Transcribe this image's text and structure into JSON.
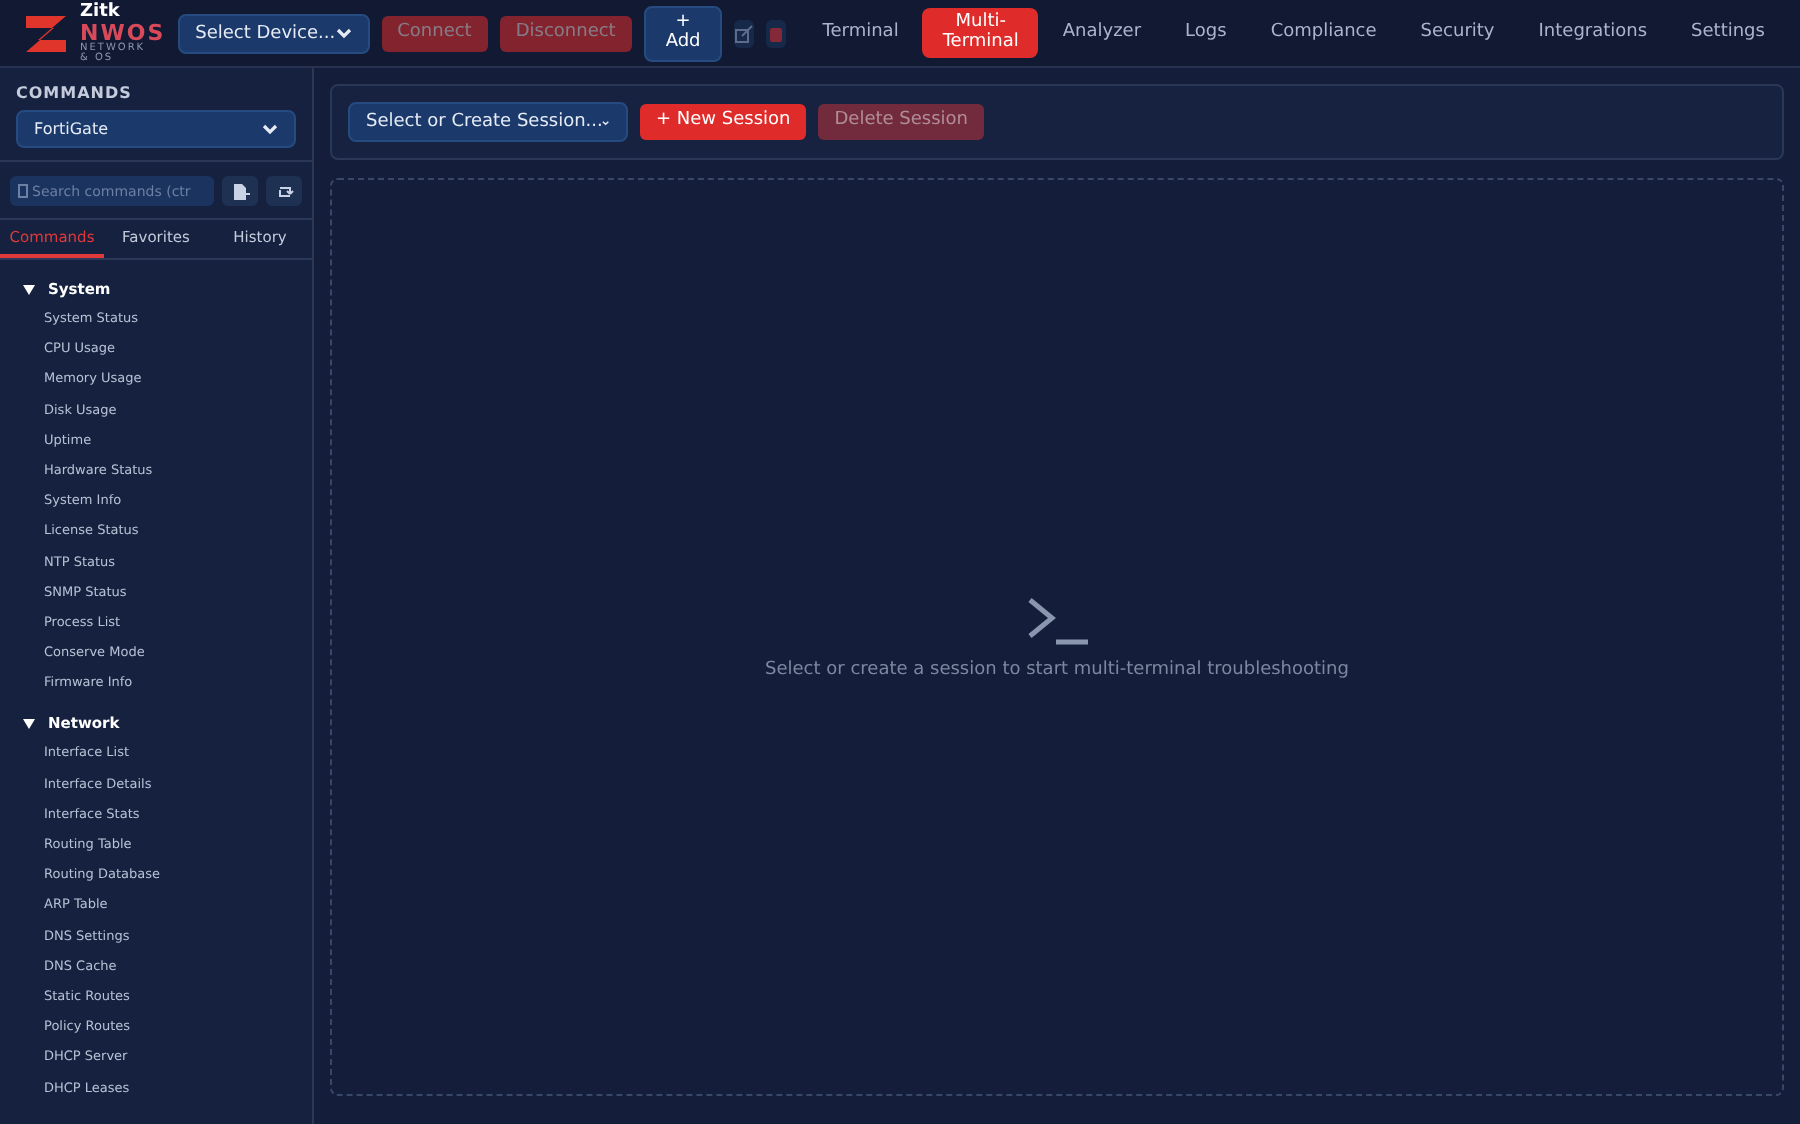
{
  "logo": {
    "top": "Zitk",
    "name": "NWOS",
    "tagline": "NETWORK & OS"
  },
  "header": {
    "device_select": "Select Device...",
    "buttons": [
      {
        "label": "Connect",
        "kind": "danger",
        "disabled": true
      },
      {
        "label": "Disconnect",
        "kind": "danger",
        "disabled": true
      },
      {
        "label": "+\nAdd",
        "kind": "primary",
        "disabled": false
      }
    ],
    "icon_buttons": [
      {
        "kind": "edit",
        "disabled": true
      },
      {
        "kind": "delete",
        "disabled": true
      }
    ],
    "nav": [
      {
        "label": "Terminal",
        "selected": false
      },
      {
        "label": "Multi-\nTerminal",
        "selected": true
      },
      {
        "label": "Analyzer",
        "selected": false
      },
      {
        "label": "Logs",
        "selected": false
      },
      {
        "label": "Compliance",
        "selected": false
      },
      {
        "label": "Security",
        "selected": false
      },
      {
        "label": "Integrations",
        "selected": false
      },
      {
        "label": "Settings",
        "selected": false
      }
    ]
  },
  "sidebar": {
    "title": "COMMANDS",
    "vendor_select": "FortiGate",
    "search": {
      "placeholder": "Search commands (ctr"
    },
    "tabs": [
      {
        "label": "Commands",
        "selected": true
      },
      {
        "label": "Favorites",
        "selected": false
      },
      {
        "label": "History",
        "selected": false
      }
    ],
    "groups": [
      {
        "label": "System",
        "expanded": true,
        "children": [
          "System Status",
          "CPU Usage",
          "Memory Usage",
          "Disk Usage",
          "Uptime",
          "Hardware Status",
          "System Info",
          "License Status",
          "NTP Status",
          "SNMP Status",
          "Process List",
          "Conserve Mode",
          "Firmware Info"
        ]
      },
      {
        "label": "Network",
        "expanded": true,
        "children": [
          "Interface List",
          "Interface Details",
          "Interface Stats",
          "Routing Table",
          "Routing Database",
          "ARP Table",
          "DNS Settings",
          "DNS Cache",
          "Static Routes",
          "Policy Routes",
          "DHCP Server",
          "DHCP Leases"
        ]
      }
    ]
  },
  "session_bar": {
    "session_select": "Select or Create Session...",
    "buttons": [
      {
        "label": "+ New Session",
        "disabled": false
      },
      {
        "label": "Delete Session",
        "disabled": true
      }
    ]
  },
  "empty_state": {
    "message": "Select or create a session to start multi-terminal troubleshooting"
  }
}
